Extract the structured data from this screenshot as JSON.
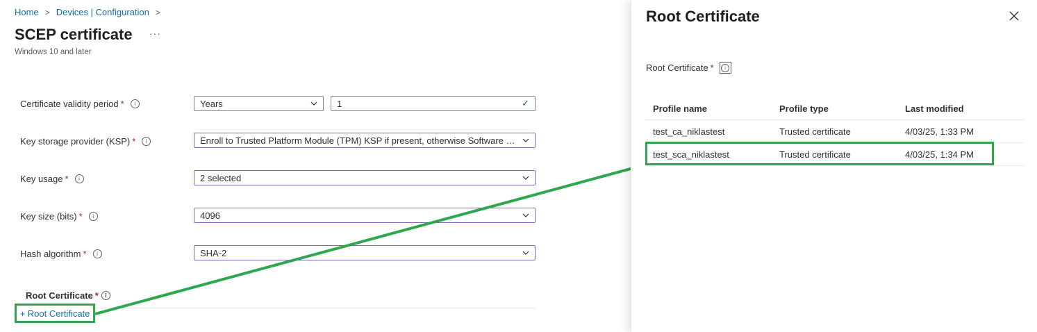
{
  "breadcrumb": [
    "Home",
    "Devices | Configuration"
  ],
  "page": {
    "title": "SCEP certificate",
    "subtitle": "Windows 10 and later",
    "more_icon": "ellipsis-icon"
  },
  "fields": {
    "validity": {
      "label": "Certificate validity period",
      "unit": "Years",
      "value": "1"
    },
    "ksp": {
      "label": "Key storage provider (KSP)",
      "value": "Enroll to Trusted Platform Module (TPM) KSP if present, otherwise Software K..."
    },
    "key_usage": {
      "label": "Key usage",
      "value": "2 selected"
    },
    "key_size": {
      "label": "Key size (bits)",
      "value": "4096"
    },
    "hash": {
      "label": "Hash algorithm",
      "value": "SHA-2"
    },
    "root": {
      "label": "Root Certificate",
      "add_label": "+ Root Certificate"
    }
  },
  "required_marker": "*",
  "panel": {
    "title": "Root Certificate",
    "field_label": "Root Certificate",
    "columns": [
      "Profile name",
      "Profile type",
      "Last modified"
    ],
    "rows": [
      {
        "name": "test_ca_niklastest",
        "type": "Trusted certificate",
        "modified": "4/03/25, 1:33 PM"
      },
      {
        "name": "test_sca_niklastest",
        "type": "Trusted certificate",
        "modified": "4/03/25, 1:34 PM"
      }
    ]
  },
  "colors": {
    "accent": "#0f6cbd",
    "highlight": "#2ea84e",
    "required": "#a4262c"
  }
}
